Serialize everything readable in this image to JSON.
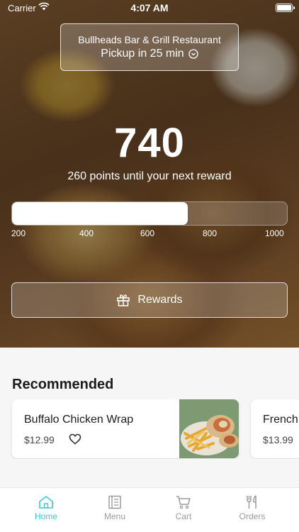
{
  "status_bar": {
    "carrier": "Carrier",
    "time": "4:07 AM"
  },
  "restaurant": {
    "name": "Bullheads Bar & Grill Restaurant",
    "pickup": "Pickup in 25 min"
  },
  "rewards": {
    "points": "740",
    "subtitle": "260 points until your next reward",
    "progress_fraction": 0.64,
    "ticks": [
      "200",
      "400",
      "600",
      "800",
      "1000"
    ],
    "button_label": "Rewards"
  },
  "recommended": {
    "title": "Recommended",
    "items": [
      {
        "name": "Buffalo Chicken Wrap",
        "price": "$12.99"
      },
      {
        "name": "French",
        "price": "$13.99"
      }
    ]
  },
  "tabs": [
    {
      "label": "Home",
      "icon": "home-icon",
      "active": true
    },
    {
      "label": "Menu",
      "icon": "menu-icon",
      "active": false
    },
    {
      "label": "Cart",
      "icon": "cart-icon",
      "active": false
    },
    {
      "label": "Orders",
      "icon": "fork-knife-icon",
      "active": false
    }
  ],
  "colors": {
    "accent": "#3cc7d9",
    "inactive": "#9b9b9b"
  }
}
